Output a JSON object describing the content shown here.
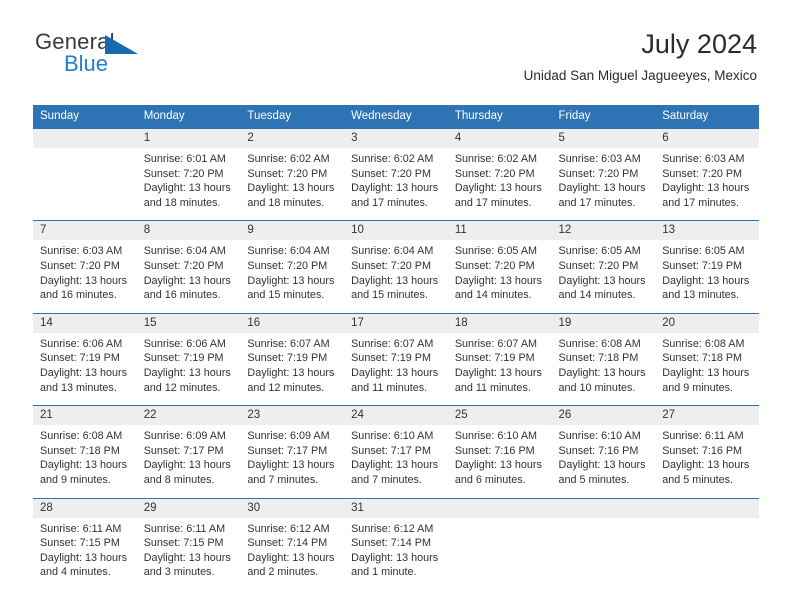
{
  "brand": {
    "word_one": "General",
    "word_two": "Blue",
    "flag_icon": "flag-triangle-icon"
  },
  "header": {
    "title": "July 2024",
    "subtitle": "Unidad San Miguel Jagueeyes, Mexico"
  },
  "colors": {
    "header_blue": "#2e73b3",
    "brand_blue": "#1f7fd0",
    "flag_blue": "#1769b0",
    "daynum_band": "#eeeeee",
    "text": "#333333"
  },
  "calendar": {
    "weekday_headers": [
      "Sunday",
      "Monday",
      "Tuesday",
      "Wednesday",
      "Thursday",
      "Friday",
      "Saturday"
    ],
    "weeks": [
      [
        {
          "day": "",
          "sunrise": "",
          "sunset": "",
          "daylight_1": "",
          "daylight_2": ""
        },
        {
          "day": "1",
          "sunrise": "Sunrise: 6:01 AM",
          "sunset": "Sunset: 7:20 PM",
          "daylight_1": "Daylight: 13 hours",
          "daylight_2": "and 18 minutes."
        },
        {
          "day": "2",
          "sunrise": "Sunrise: 6:02 AM",
          "sunset": "Sunset: 7:20 PM",
          "daylight_1": "Daylight: 13 hours",
          "daylight_2": "and 18 minutes."
        },
        {
          "day": "3",
          "sunrise": "Sunrise: 6:02 AM",
          "sunset": "Sunset: 7:20 PM",
          "daylight_1": "Daylight: 13 hours",
          "daylight_2": "and 17 minutes."
        },
        {
          "day": "4",
          "sunrise": "Sunrise: 6:02 AM",
          "sunset": "Sunset: 7:20 PM",
          "daylight_1": "Daylight: 13 hours",
          "daylight_2": "and 17 minutes."
        },
        {
          "day": "5",
          "sunrise": "Sunrise: 6:03 AM",
          "sunset": "Sunset: 7:20 PM",
          "daylight_1": "Daylight: 13 hours",
          "daylight_2": "and 17 minutes."
        },
        {
          "day": "6",
          "sunrise": "Sunrise: 6:03 AM",
          "sunset": "Sunset: 7:20 PM",
          "daylight_1": "Daylight: 13 hours",
          "daylight_2": "and 17 minutes."
        }
      ],
      [
        {
          "day": "7",
          "sunrise": "Sunrise: 6:03 AM",
          "sunset": "Sunset: 7:20 PM",
          "daylight_1": "Daylight: 13 hours",
          "daylight_2": "and 16 minutes."
        },
        {
          "day": "8",
          "sunrise": "Sunrise: 6:04 AM",
          "sunset": "Sunset: 7:20 PM",
          "daylight_1": "Daylight: 13 hours",
          "daylight_2": "and 16 minutes."
        },
        {
          "day": "9",
          "sunrise": "Sunrise: 6:04 AM",
          "sunset": "Sunset: 7:20 PM",
          "daylight_1": "Daylight: 13 hours",
          "daylight_2": "and 15 minutes."
        },
        {
          "day": "10",
          "sunrise": "Sunrise: 6:04 AM",
          "sunset": "Sunset: 7:20 PM",
          "daylight_1": "Daylight: 13 hours",
          "daylight_2": "and 15 minutes."
        },
        {
          "day": "11",
          "sunrise": "Sunrise: 6:05 AM",
          "sunset": "Sunset: 7:20 PM",
          "daylight_1": "Daylight: 13 hours",
          "daylight_2": "and 14 minutes."
        },
        {
          "day": "12",
          "sunrise": "Sunrise: 6:05 AM",
          "sunset": "Sunset: 7:20 PM",
          "daylight_1": "Daylight: 13 hours",
          "daylight_2": "and 14 minutes."
        },
        {
          "day": "13",
          "sunrise": "Sunrise: 6:05 AM",
          "sunset": "Sunset: 7:19 PM",
          "daylight_1": "Daylight: 13 hours",
          "daylight_2": "and 13 minutes."
        }
      ],
      [
        {
          "day": "14",
          "sunrise": "Sunrise: 6:06 AM",
          "sunset": "Sunset: 7:19 PM",
          "daylight_1": "Daylight: 13 hours",
          "daylight_2": "and 13 minutes."
        },
        {
          "day": "15",
          "sunrise": "Sunrise: 6:06 AM",
          "sunset": "Sunset: 7:19 PM",
          "daylight_1": "Daylight: 13 hours",
          "daylight_2": "and 12 minutes."
        },
        {
          "day": "16",
          "sunrise": "Sunrise: 6:07 AM",
          "sunset": "Sunset: 7:19 PM",
          "daylight_1": "Daylight: 13 hours",
          "daylight_2": "and 12 minutes."
        },
        {
          "day": "17",
          "sunrise": "Sunrise: 6:07 AM",
          "sunset": "Sunset: 7:19 PM",
          "daylight_1": "Daylight: 13 hours",
          "daylight_2": "and 11 minutes."
        },
        {
          "day": "18",
          "sunrise": "Sunrise: 6:07 AM",
          "sunset": "Sunset: 7:19 PM",
          "daylight_1": "Daylight: 13 hours",
          "daylight_2": "and 11 minutes."
        },
        {
          "day": "19",
          "sunrise": "Sunrise: 6:08 AM",
          "sunset": "Sunset: 7:18 PM",
          "daylight_1": "Daylight: 13 hours",
          "daylight_2": "and 10 minutes."
        },
        {
          "day": "20",
          "sunrise": "Sunrise: 6:08 AM",
          "sunset": "Sunset: 7:18 PM",
          "daylight_1": "Daylight: 13 hours",
          "daylight_2": "and 9 minutes."
        }
      ],
      [
        {
          "day": "21",
          "sunrise": "Sunrise: 6:08 AM",
          "sunset": "Sunset: 7:18 PM",
          "daylight_1": "Daylight: 13 hours",
          "daylight_2": "and 9 minutes."
        },
        {
          "day": "22",
          "sunrise": "Sunrise: 6:09 AM",
          "sunset": "Sunset: 7:17 PM",
          "daylight_1": "Daylight: 13 hours",
          "daylight_2": "and 8 minutes."
        },
        {
          "day": "23",
          "sunrise": "Sunrise: 6:09 AM",
          "sunset": "Sunset: 7:17 PM",
          "daylight_1": "Daylight: 13 hours",
          "daylight_2": "and 7 minutes."
        },
        {
          "day": "24",
          "sunrise": "Sunrise: 6:10 AM",
          "sunset": "Sunset: 7:17 PM",
          "daylight_1": "Daylight: 13 hours",
          "daylight_2": "and 7 minutes."
        },
        {
          "day": "25",
          "sunrise": "Sunrise: 6:10 AM",
          "sunset": "Sunset: 7:16 PM",
          "daylight_1": "Daylight: 13 hours",
          "daylight_2": "and 6 minutes."
        },
        {
          "day": "26",
          "sunrise": "Sunrise: 6:10 AM",
          "sunset": "Sunset: 7:16 PM",
          "daylight_1": "Daylight: 13 hours",
          "daylight_2": "and 5 minutes."
        },
        {
          "day": "27",
          "sunrise": "Sunrise: 6:11 AM",
          "sunset": "Sunset: 7:16 PM",
          "daylight_1": "Daylight: 13 hours",
          "daylight_2": "and 5 minutes."
        }
      ],
      [
        {
          "day": "28",
          "sunrise": "Sunrise: 6:11 AM",
          "sunset": "Sunset: 7:15 PM",
          "daylight_1": "Daylight: 13 hours",
          "daylight_2": "and 4 minutes."
        },
        {
          "day": "29",
          "sunrise": "Sunrise: 6:11 AM",
          "sunset": "Sunset: 7:15 PM",
          "daylight_1": "Daylight: 13 hours",
          "daylight_2": "and 3 minutes."
        },
        {
          "day": "30",
          "sunrise": "Sunrise: 6:12 AM",
          "sunset": "Sunset: 7:14 PM",
          "daylight_1": "Daylight: 13 hours",
          "daylight_2": "and 2 minutes."
        },
        {
          "day": "31",
          "sunrise": "Sunrise: 6:12 AM",
          "sunset": "Sunset: 7:14 PM",
          "daylight_1": "Daylight: 13 hours",
          "daylight_2": "and 1 minute."
        },
        {
          "day": "",
          "sunrise": "",
          "sunset": "",
          "daylight_1": "",
          "daylight_2": ""
        },
        {
          "day": "",
          "sunrise": "",
          "sunset": "",
          "daylight_1": "",
          "daylight_2": ""
        },
        {
          "day": "",
          "sunrise": "",
          "sunset": "",
          "daylight_1": "",
          "daylight_2": ""
        }
      ]
    ]
  }
}
